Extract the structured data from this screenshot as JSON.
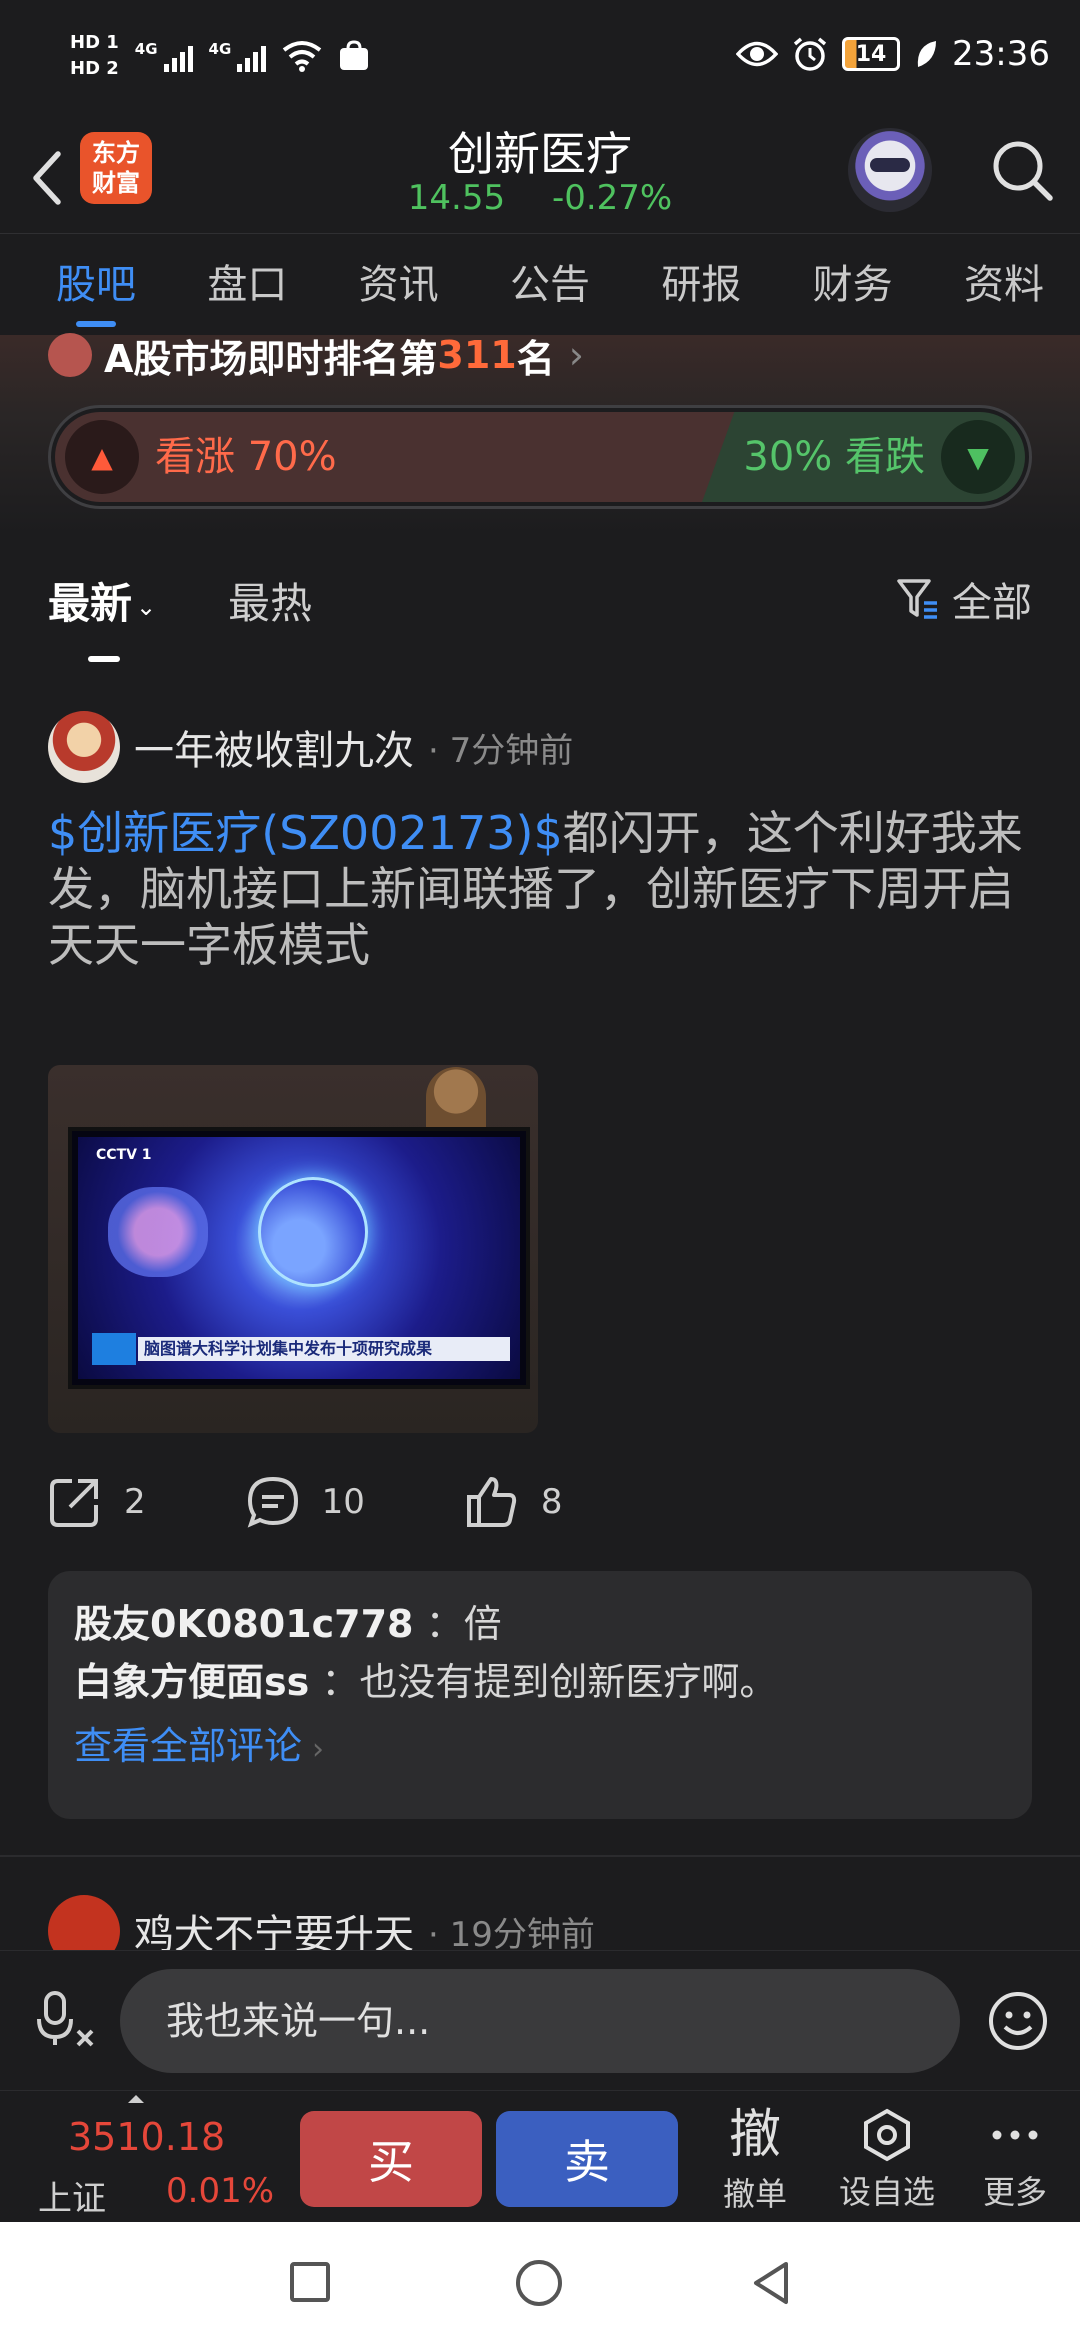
{
  "statusbar": {
    "hd1": "HD 1",
    "hd2": "HD 2",
    "sig1_label": "4G",
    "sig2_label": "4G",
    "battery": "14",
    "time": "23:36"
  },
  "header": {
    "logo_line1": "东方",
    "logo_line2": "财富",
    "title": "创新医疗",
    "price": "14.55",
    "change": "-0.27%"
  },
  "tabs": [
    "股吧",
    "盘口",
    "资讯",
    "公告",
    "研报",
    "财务",
    "资料"
  ],
  "ranking": {
    "text": "A股市场即时排名第",
    "rank": "311",
    "suffix": "名"
  },
  "sentiment": {
    "bull_label": "看涨 70%",
    "bear_label": "30% 看跌",
    "bull_fraction": 0.7
  },
  "sort": {
    "latest": "最新",
    "hot": "最热",
    "filter": "全部"
  },
  "post": {
    "author": "一年被收割九次",
    "time": "· 7分钟前",
    "stock_tag": "$创新医疗(SZ002173)$",
    "body": "都闪开，这个利好我来发，脑机接口上新闻联播了，创新医疗下周开启天天一字板模式",
    "image": {
      "tv_logo": "CCTV 1",
      "caption": "脑图谱大科学计划集中发布十项研究成果"
    },
    "shares": "2",
    "comments_count": "10",
    "likes": "8",
    "comments": [
      {
        "user": "股友0K0801c778",
        "text": "：倍"
      },
      {
        "user": "白象方便面ss",
        "text": "：也没有提到创新医疗啊。"
      }
    ],
    "view_all": "查看全部评论"
  },
  "post2": {
    "author": "鸡犬不宁要升天",
    "time": "· 19分钟前"
  },
  "input": {
    "placeholder": "我也来说一句..."
  },
  "tradebar": {
    "index_value": "3510.18",
    "index_name": "上证",
    "index_pct": "0.01%",
    "buy": "买",
    "sell": "卖",
    "cancel_glyph": "撤",
    "cancel_label": "撤单",
    "watch_label": "设自选",
    "more_label": "更多"
  },
  "colors": {
    "accent": "#3f8ef5",
    "up": "#e5473a",
    "down": "#4fc25f",
    "background": "#1c1c1e"
  }
}
